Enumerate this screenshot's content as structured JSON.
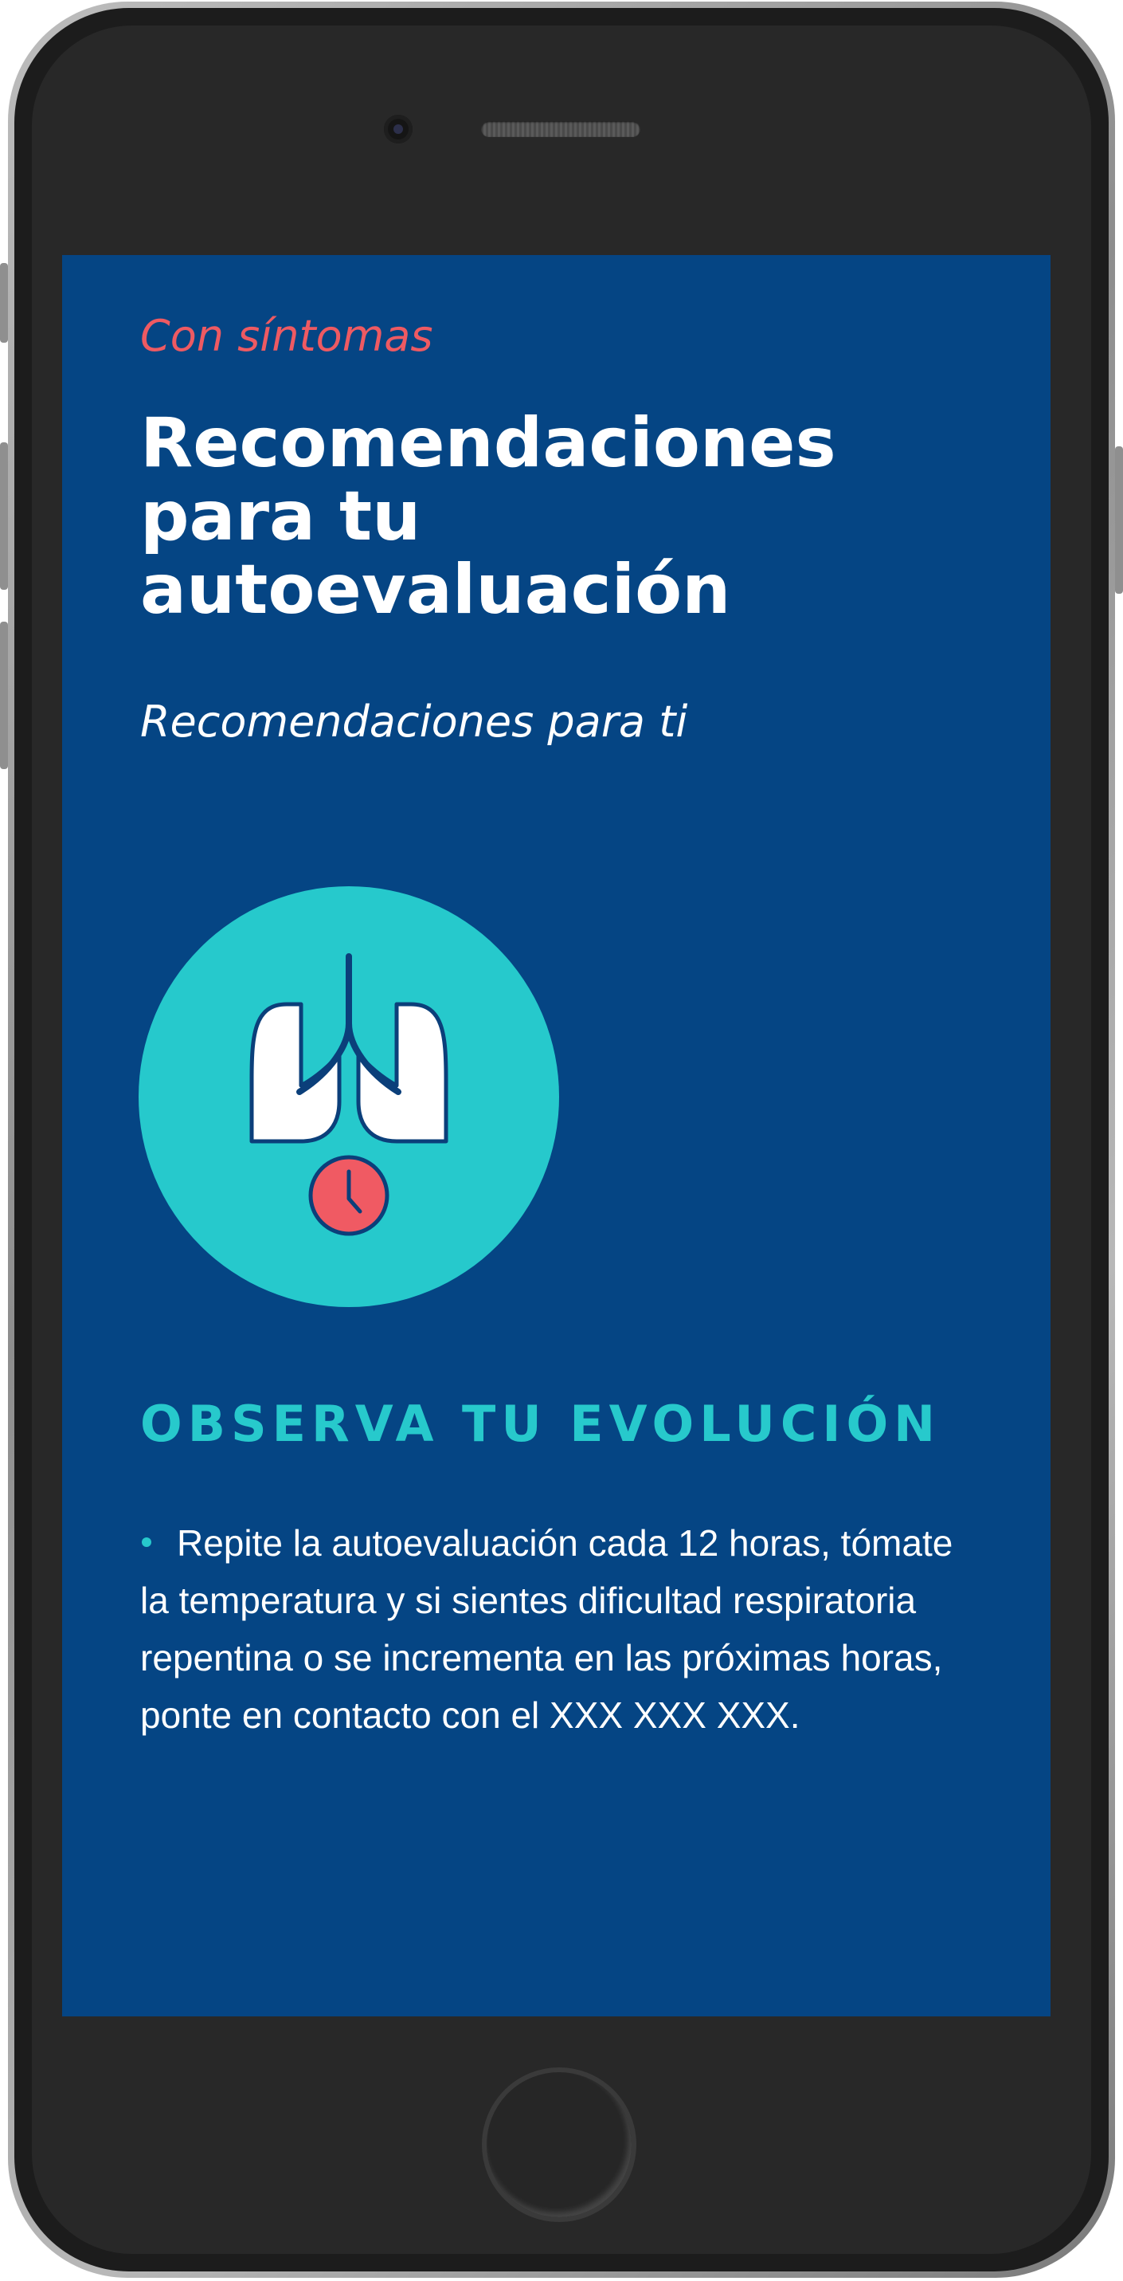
{
  "screen": {
    "background_color": "#054584",
    "eyebrow": "Con síntomas",
    "title": "Recomendaciones para tu autoevaluación",
    "subtitle": "Recomendaciones para ti",
    "illustration": {
      "icon": "lungs-with-clock-icon",
      "circle_color": "#26c9cc",
      "clock_color": "#f05a63"
    },
    "section": {
      "heading": "OBSERVA TU EVOLUCIÓN",
      "items": [
        "Repite la autoevaluación cada 12 horas, tómate la temperatura y si sientes dificultad respiratoria repentina o se incrementa en las próximas horas, ponte en contacto con el XXX XXX XXX."
      ]
    }
  }
}
